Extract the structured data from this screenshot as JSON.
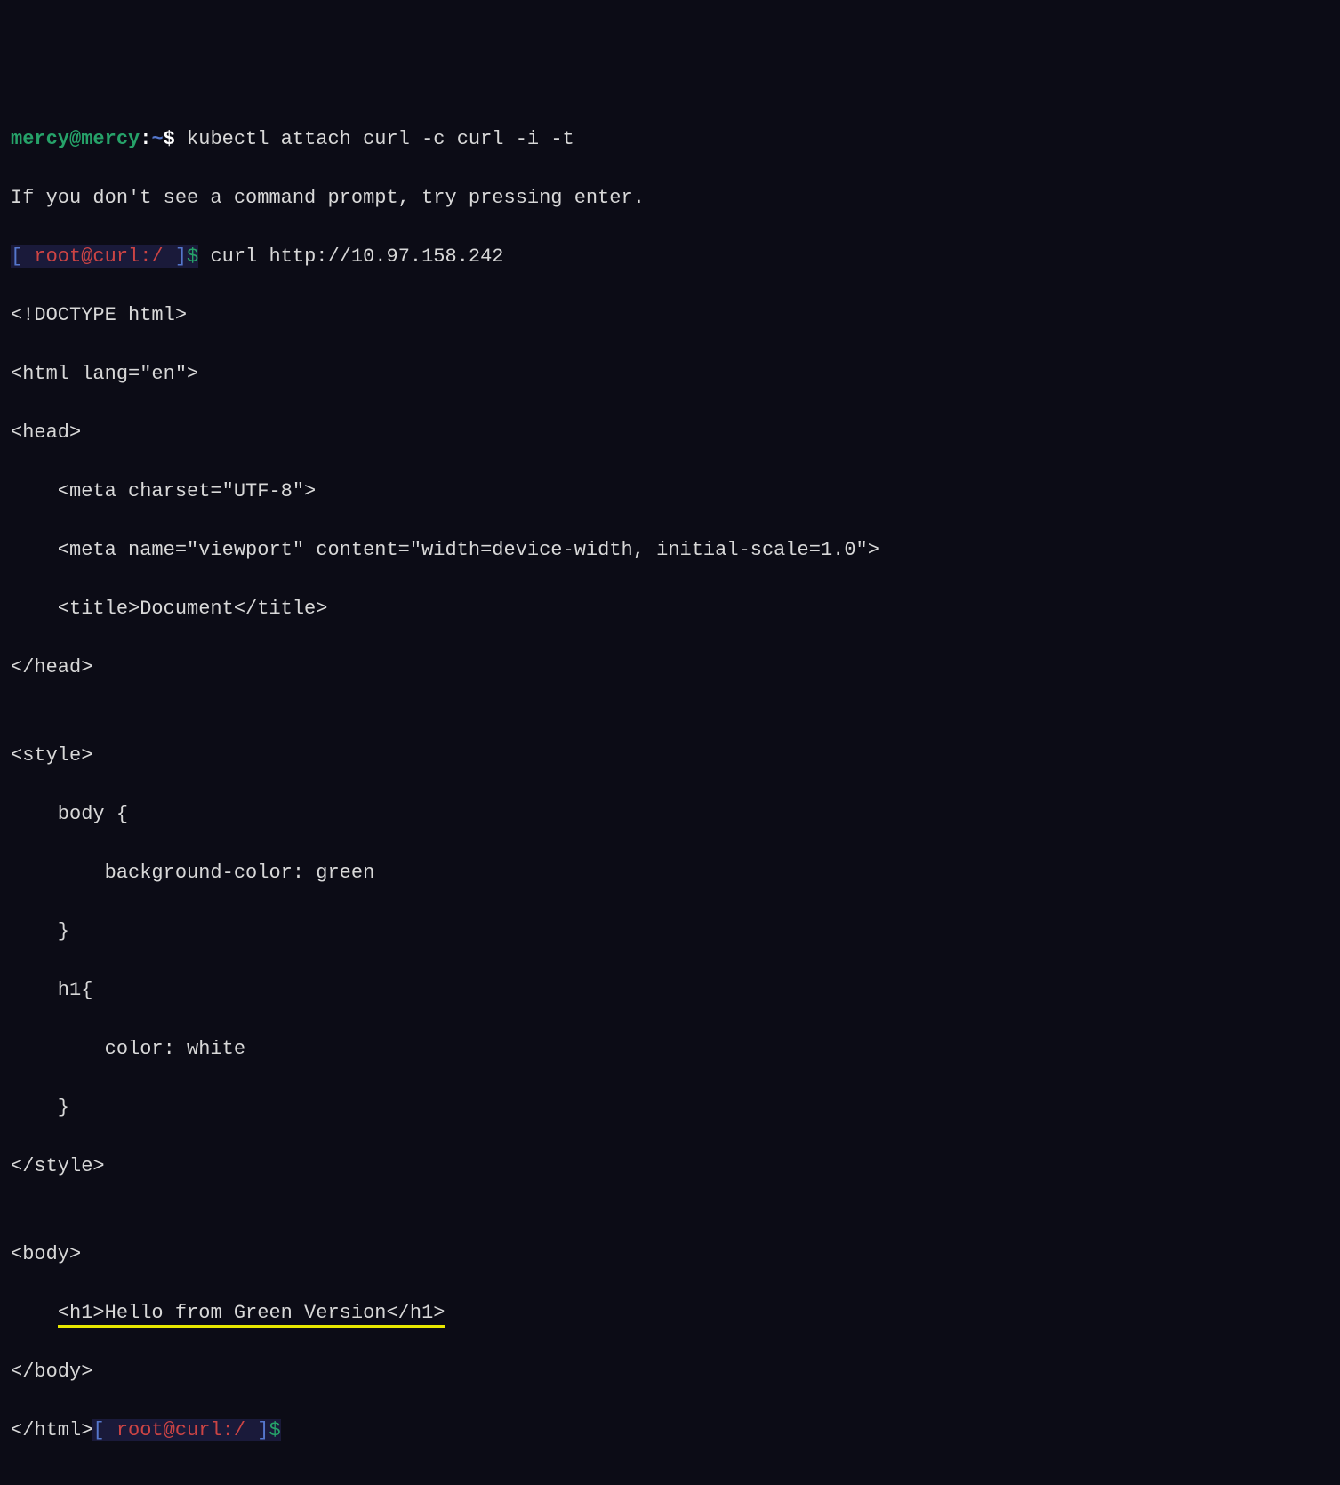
{
  "line1": {
    "user_host": "mercy@mercy",
    "colon": ":",
    "tilde": "~",
    "dollar": "$ ",
    "command": "kubectl attach curl -c curl -i -t"
  },
  "line2": "If you don't see a command prompt, try pressing enter.",
  "line3": {
    "bracket_open": "[ ",
    "root": "root@curl:/ ",
    "bracket_close": "]",
    "dollar": "$",
    "space": " ",
    "command": "curl http://10.97.158.242"
  },
  "output": {
    "l1": "<!DOCTYPE html>",
    "l2": "<html lang=\"en\">",
    "l3": "<head>",
    "l4": "    <meta charset=\"UTF-8\">",
    "l5": "    <meta name=\"viewport\" content=\"width=device-width, initial-scale=1.0\">",
    "l6": "    <title>Document</title>",
    "l7": "</head>",
    "l8": "",
    "l9": "<style>",
    "l10": "    body {",
    "l11": "        background-color: green",
    "l12": "    }",
    "l13": "    h1{",
    "l14": "        color: white",
    "l15": "    }",
    "l16": "</style>",
    "l17": "",
    "l18": "<body>",
    "l19_pre": "    ",
    "l19_hl": "<h1>Hello from Green Version</h1>",
    "l20": "</body>",
    "l21": "</html>"
  },
  "endprompt": {
    "bracket_open": "[ ",
    "root": "root@curl:/ ",
    "bracket_close": "]",
    "dollar": "$"
  }
}
